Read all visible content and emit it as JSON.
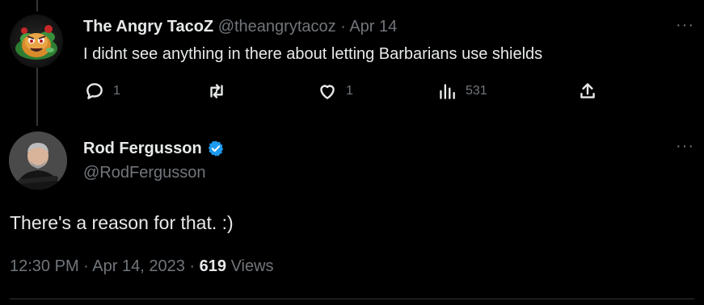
{
  "reply": {
    "display_name": "The Angry TacoZ",
    "handle": "@theangrytacoz",
    "separator": "·",
    "date": "Apr 14",
    "text": "I didnt see anything in there about letting Barbarians use shields",
    "more_label": "···",
    "actions": {
      "replies": "1",
      "retweets": "",
      "likes": "1",
      "views": "531"
    }
  },
  "tweet": {
    "display_name": "Rod Fergusson",
    "handle": "@RodFergusson",
    "verified": true,
    "more_label": "···",
    "text": "There's a reason for that. :)",
    "time": "12:30 PM",
    "separator": "·",
    "date": "Apr 14, 2023",
    "views_count": "619",
    "views_label": "Views"
  },
  "colors": {
    "background": "#000000",
    "text_primary": "#e7e9ea",
    "text_secondary": "#71767b",
    "verified_blue": "#1d9bf0",
    "thread_line": "#333639"
  },
  "icons": [
    "reply-icon",
    "retweet-icon",
    "like-icon",
    "views-icon",
    "share-icon",
    "verified-badge-icon",
    "more-icon"
  ]
}
